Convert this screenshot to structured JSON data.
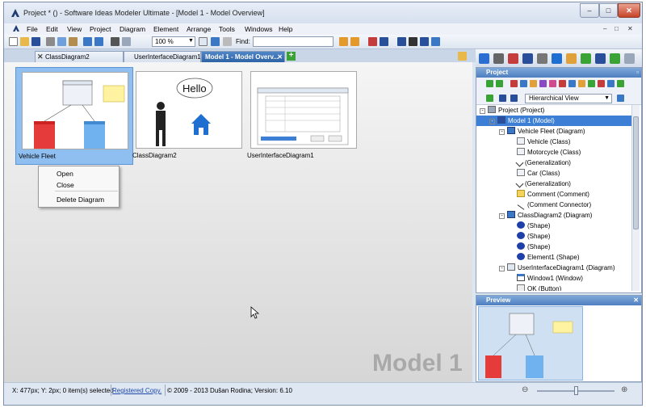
{
  "window": {
    "title": "Project * () - Software Ideas Modeler Ultimate - [Model 1 - Model Overview]",
    "minimize": "–",
    "maximize": "□",
    "close": "✕"
  },
  "menu": [
    "File",
    "Edit",
    "View",
    "Project",
    "Diagram",
    "Element",
    "Arrange",
    "Tools",
    "Windows",
    "Help"
  ],
  "mdi_controls": [
    "–",
    "□",
    "✕"
  ],
  "toolbar": {
    "zoom_value": "100 %",
    "find_label": "Find:",
    "find_value": ""
  },
  "tabs": [
    {
      "label": "ClassDiagram2"
    },
    {
      "label": "UserInterfaceDiagram1"
    },
    {
      "label": "Model 1 - Model Overv..."
    }
  ],
  "overview": {
    "watermark": "Model 1",
    "thumbnails": [
      {
        "label": "Vehicle Fleet",
        "selected": true
      },
      {
        "label": "ClassDiagram2",
        "selected": false,
        "hello": "Hello"
      },
      {
        "label": "UserInterfaceDiagram1",
        "selected": false
      }
    ]
  },
  "context_menu": [
    "Open",
    "Close",
    "Delete Diagram"
  ],
  "project_panel": {
    "title": "Project",
    "view_select": "Hierarchical View",
    "tree": [
      {
        "label": "Project (Project)",
        "level": 0,
        "icon": "project-icon",
        "expander": "-"
      },
      {
        "label": "Model 1 (Model)",
        "level": 1,
        "icon": "model-icon",
        "expander": "-",
        "selected": true
      },
      {
        "label": "Vehicle Fleet (Diagram)",
        "level": 2,
        "icon": "diagram-icon",
        "expander": "-"
      },
      {
        "label": "Vehicle (Class)",
        "level": 3,
        "icon": "class-icon"
      },
      {
        "label": "Motorcycle (Class)",
        "level": 3,
        "icon": "class-icon"
      },
      {
        "label": "(Generalization)",
        "level": 3,
        "icon": "generalization-icon"
      },
      {
        "label": "Car (Class)",
        "level": 3,
        "icon": "class-icon"
      },
      {
        "label": "(Generalization)",
        "level": 3,
        "icon": "generalization-icon"
      },
      {
        "label": "Comment (Comment)",
        "level": 3,
        "icon": "comment-icon"
      },
      {
        "label": "(Comment Connector)",
        "level": 3,
        "icon": "connector-icon"
      },
      {
        "label": "ClassDiagram2 (Diagram)",
        "level": 2,
        "icon": "diagram-icon",
        "expander": "-"
      },
      {
        "label": "(Shape)",
        "level": 3,
        "icon": "shape-icon"
      },
      {
        "label": "(Shape)",
        "level": 3,
        "icon": "shape-icon"
      },
      {
        "label": "(Shape)",
        "level": 3,
        "icon": "shape-icon"
      },
      {
        "label": "Element1 (Shape)",
        "level": 3,
        "icon": "shape-icon"
      },
      {
        "label": "UserInterfaceDiagram1 (Diagram)",
        "level": 2,
        "icon": "ui-diagram-icon",
        "expander": "-"
      },
      {
        "label": "Window1 (Window)",
        "level": 3,
        "icon": "window-icon"
      },
      {
        "label": "OK (Button)",
        "level": 3,
        "icon": "button-icon"
      }
    ]
  },
  "preview_panel": {
    "title": "Preview"
  },
  "status": {
    "coords": "X: 477px; Y: 2px; 0 item(s) selected",
    "link": "Registered Copy.",
    "copyright": "© 2009 - 2013 Dušan Rodina; Version: 6.10"
  },
  "colors": {
    "accent": "#3d7fd4",
    "panel_header": "#4f7fc0",
    "selection": "#8fbff0"
  }
}
